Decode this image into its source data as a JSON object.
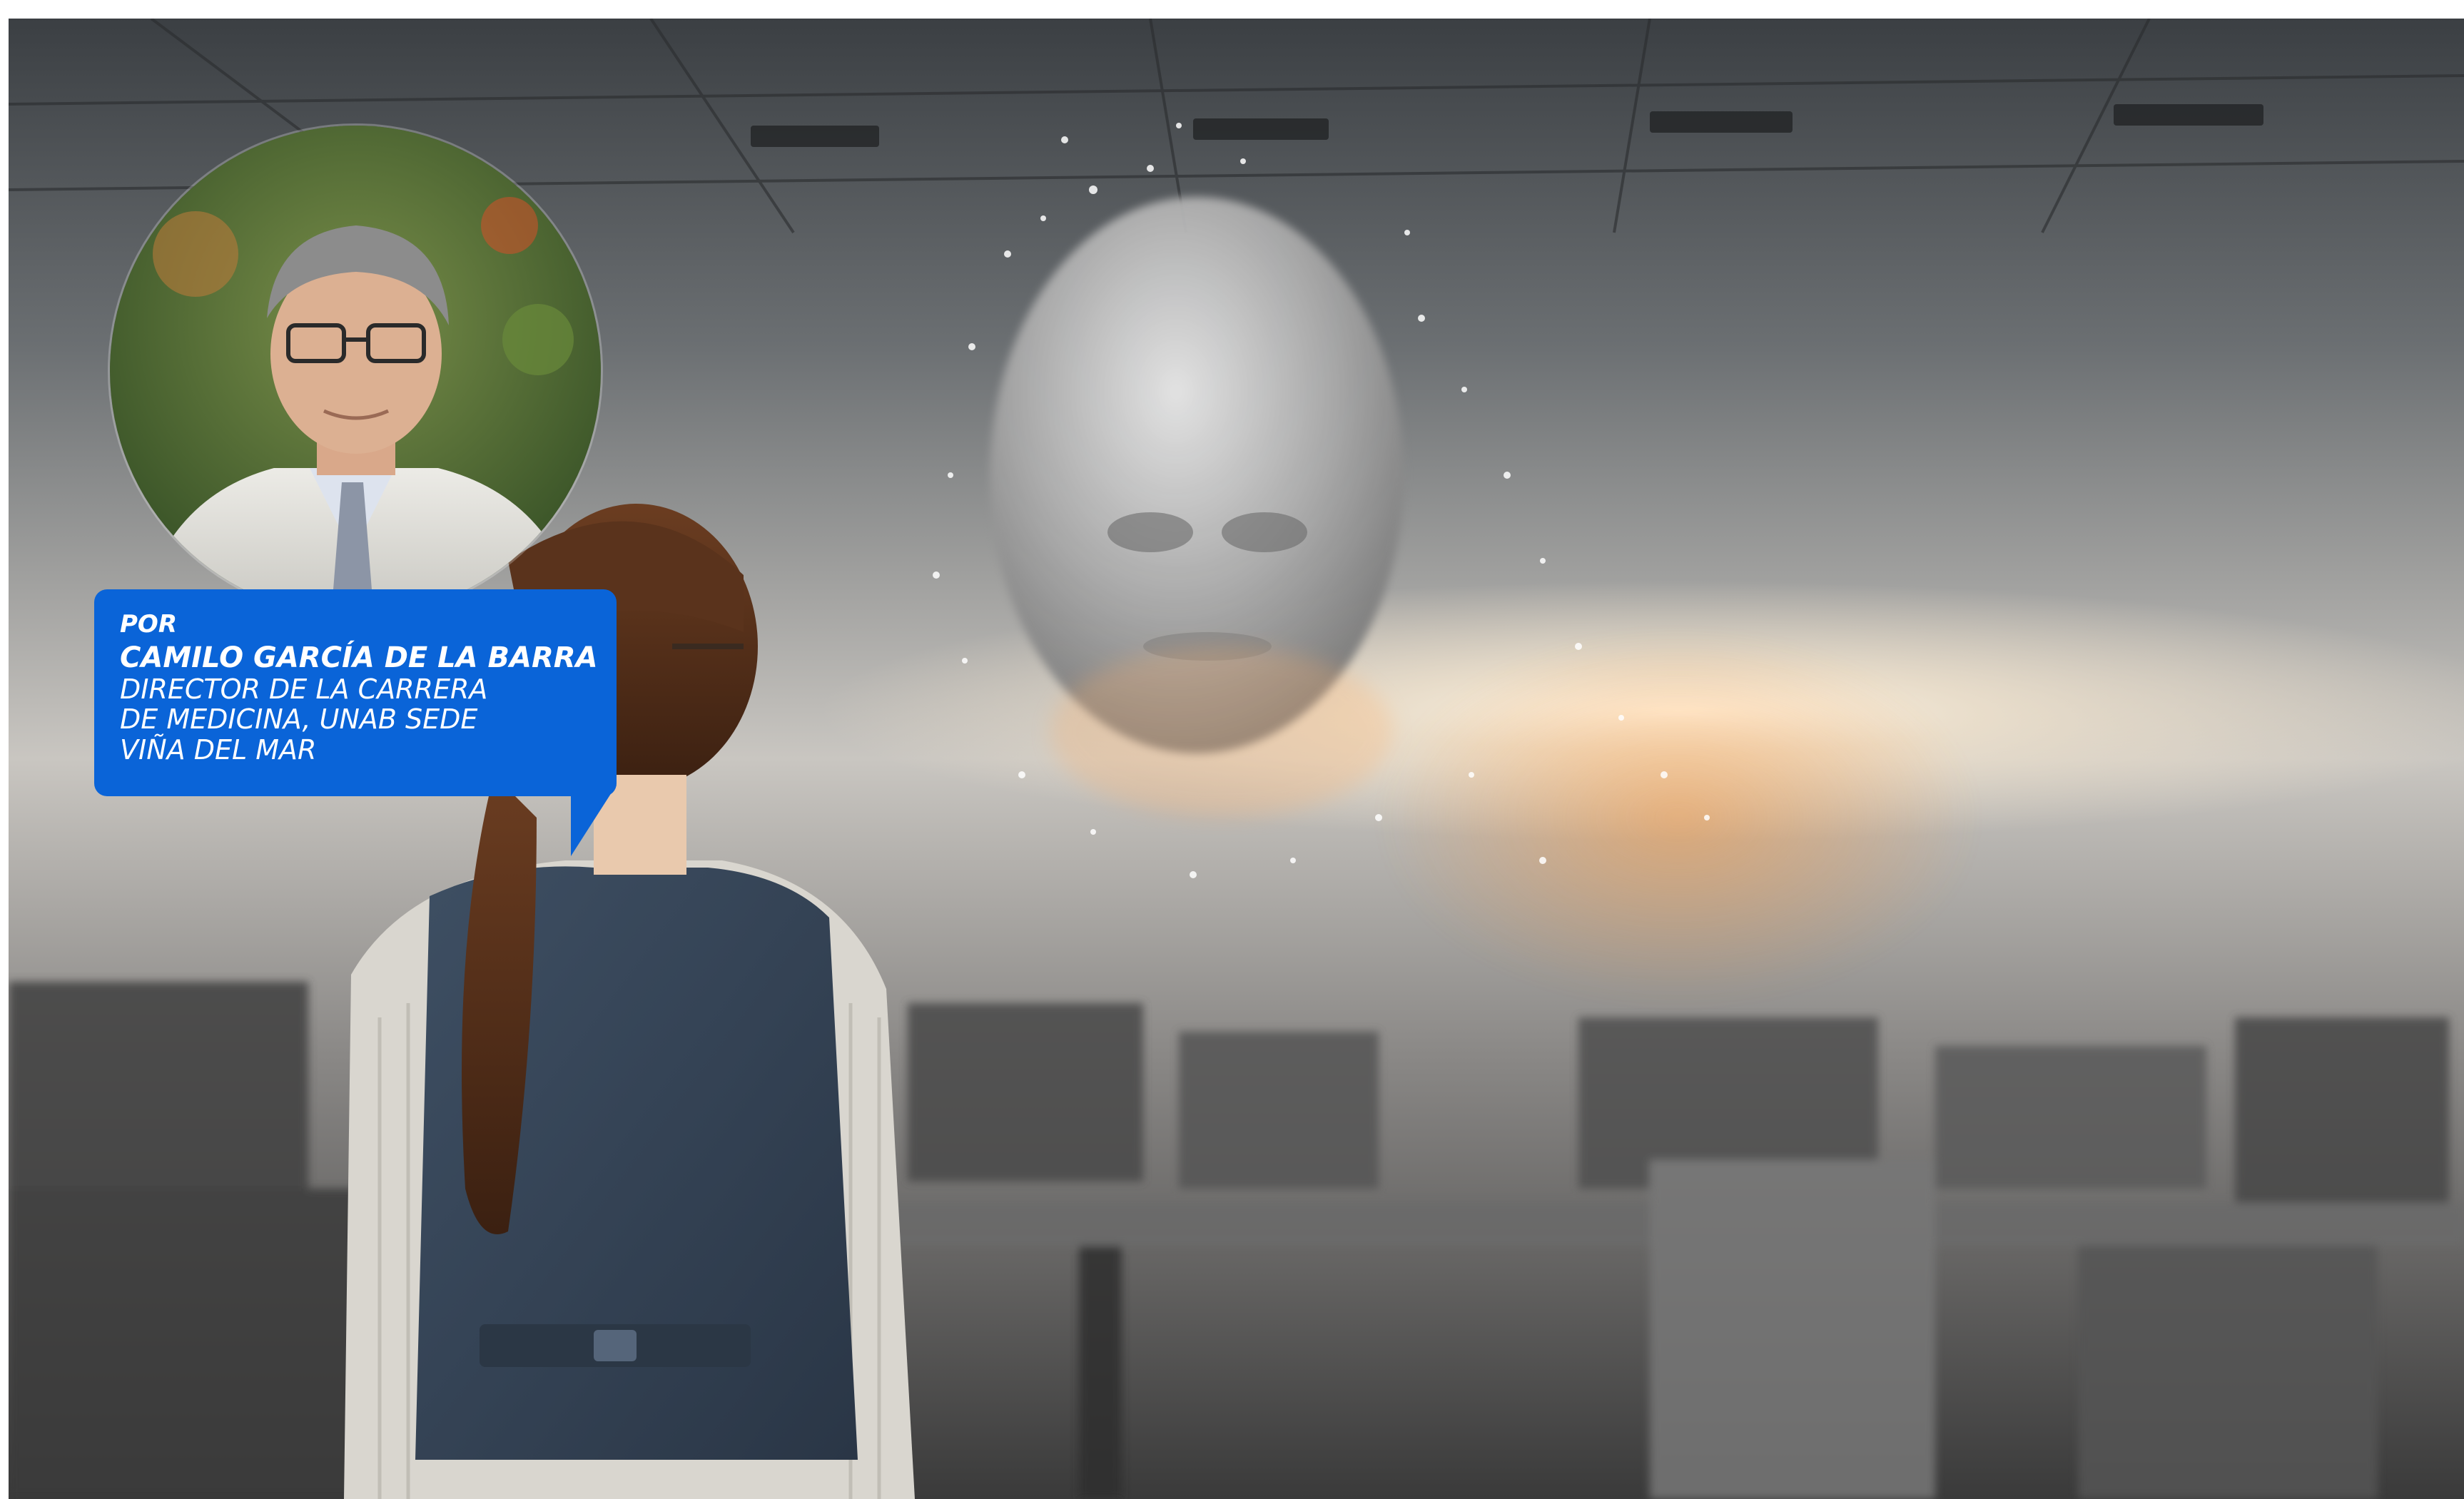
{
  "byline": {
    "prefix": "POR",
    "author": "CAMILO GARCÍA DE LA BARRA",
    "role_lines": [
      "DIRECTOR DE LA CARRERA",
      "DE MEDICINA, UNAB SEDE",
      "VIÑA DEL MAR"
    ]
  },
  "colors": {
    "bubble": "#0a64d8",
    "text": "#ffffff"
  },
  "scene": {
    "subject": "woman-in-denim-vest-back-view",
    "object": "particle-head"
  }
}
